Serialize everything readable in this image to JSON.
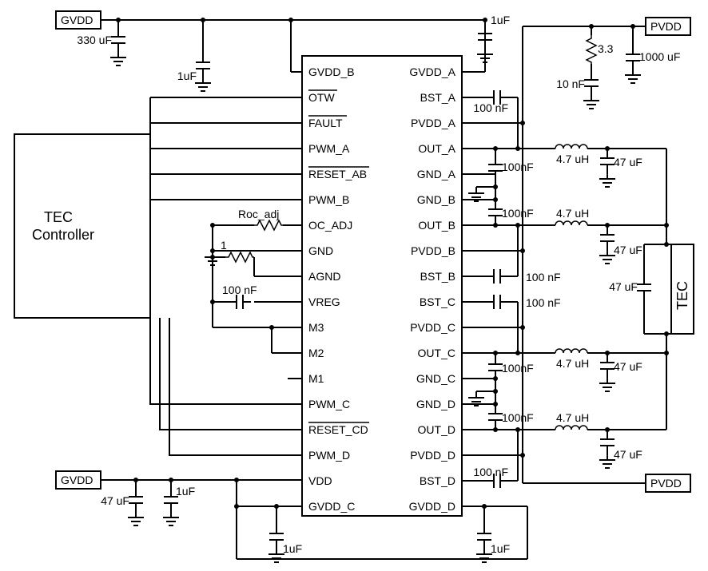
{
  "blocks": {
    "tec_controller": "TEC\nController",
    "tec_load": "TEC"
  },
  "rails": {
    "gvdd_top": "GVDD",
    "gvdd_bot": "GVDD",
    "pvdd_top": "PVDD",
    "pvdd_bot": "PVDD"
  },
  "pins_left": [
    "GVDD_B",
    "OTW",
    "FAULT",
    "PWM_A",
    "RESET_AB",
    "PWM_B",
    "OC_ADJ",
    "GND",
    "AGND",
    "VREG",
    "M3",
    "M2",
    "M1",
    "PWM_C",
    "RESET_CD",
    "PWM_D",
    "VDD",
    "GVDD_C"
  ],
  "pins_right": [
    "GVDD_A",
    "BST_A",
    "PVDD_A",
    "OUT_A",
    "GND_A",
    "GND_B",
    "OUT_B",
    "PVDD_B",
    "BST_B",
    "BST_C",
    "PVDD_C",
    "OUT_C",
    "GND_C",
    "GND_D",
    "OUT_D",
    "PVDD_D",
    "BST_D",
    "GVDD_D"
  ],
  "pins_overline": {
    "OTW": true,
    "FAULT": true,
    "RESET_AB": true,
    "RESET_CD": true
  },
  "values": {
    "c_gvdd_bulk": "330 uF",
    "c_1u_a": "1uF",
    "c_1u_b": "1uF",
    "c_1u_c": "1uF",
    "c_1u_d": "1uF",
    "c_1u_e": "1uF",
    "c_1u_f": "1uF",
    "c_47u_vdd": "47 uF",
    "r_snub": "3.3",
    "c_snub": "10 nF",
    "c_pvdd_bulk": "1000 uF",
    "r_oc": "Roc_adj",
    "r_agnd": "1",
    "c_vreg": "100 nF",
    "c_bst_a": "100 nF",
    "c_bst_b": "100 nF",
    "c_bst_c": "100 nF",
    "c_bst_d": "100 nF",
    "c_out_a": "100nF",
    "c_out_b": "100nF",
    "c_out_c": "100nF",
    "c_out_d": "100nF",
    "l_a": "4.7 uH",
    "l_b": "4.7 uH",
    "l_c": "4.7 uH",
    "l_d": "4.7 uH",
    "c_filt_a": "47 uF",
    "c_filt_b": "47 uF",
    "c_filt_c": "47 uF",
    "c_filt_d": "47 uF",
    "c_bridge": "47 uF"
  },
  "chart_data": {
    "type": "schematic",
    "description": "Application circuit: 4-channel H-bridge driver IC with TEC controller input and TEC load output, GVDD/PVDD supply rails, bootstrap caps, LC output filters.",
    "ic_pins": {
      "left": [
        "GVDD_B",
        "OTW",
        "FAULT",
        "PWM_A",
        "RESET_AB",
        "PWM_B",
        "OC_ADJ",
        "GND",
        "AGND",
        "VREG",
        "M3",
        "M2",
        "M1",
        "PWM_C",
        "RESET_CD",
        "PWM_D",
        "VDD",
        "GVDD_C"
      ],
      "right": [
        "GVDD_A",
        "BST_A",
        "PVDD_A",
        "OUT_A",
        "GND_A",
        "GND_B",
        "OUT_B",
        "PVDD_B",
        "BST_B",
        "BST_C",
        "PVDD_C",
        "OUT_C",
        "GND_C",
        "GND_D",
        "OUT_D",
        "PVDD_D",
        "BST_D",
        "GVDD_D"
      ]
    },
    "supplies": {
      "GVDD": {
        "decoupling": [
          "330 uF",
          "1uF",
          "1uF",
          "1uF",
          "1uF",
          "47 uF",
          "1uF",
          "1uF"
        ]
      },
      "PVDD": {
        "snubber": {
          "R": "3.3",
          "C": "10 nF"
        },
        "bulk": "1000 uF"
      }
    },
    "bootstrap_caps": {
      "BST_A": "100 nF",
      "BST_B": "100 nF",
      "BST_C": "100 nF",
      "BST_D": "100 nF"
    },
    "output_filters": [
      {
        "ch": "A",
        "L": "4.7 uH",
        "C": "47 uF",
        "local_C": "100nF"
      },
      {
        "ch": "B",
        "L": "4.7 uH",
        "C": "47 uF",
        "local_C": "100nF"
      },
      {
        "ch": "C",
        "L": "4.7 uH",
        "C": "47 uF",
        "local_C": "100nF"
      },
      {
        "ch": "D",
        "L": "4.7 uH",
        "C": "47 uF",
        "local_C": "100nF"
      }
    ],
    "bridge_cap": "47 uF",
    "misc": {
      "OC_ADJ": "Roc_adj",
      "AGND_R": "1",
      "VREG_C": "100 nF"
    },
    "load": "TEC",
    "controller": "TEC Controller"
  }
}
